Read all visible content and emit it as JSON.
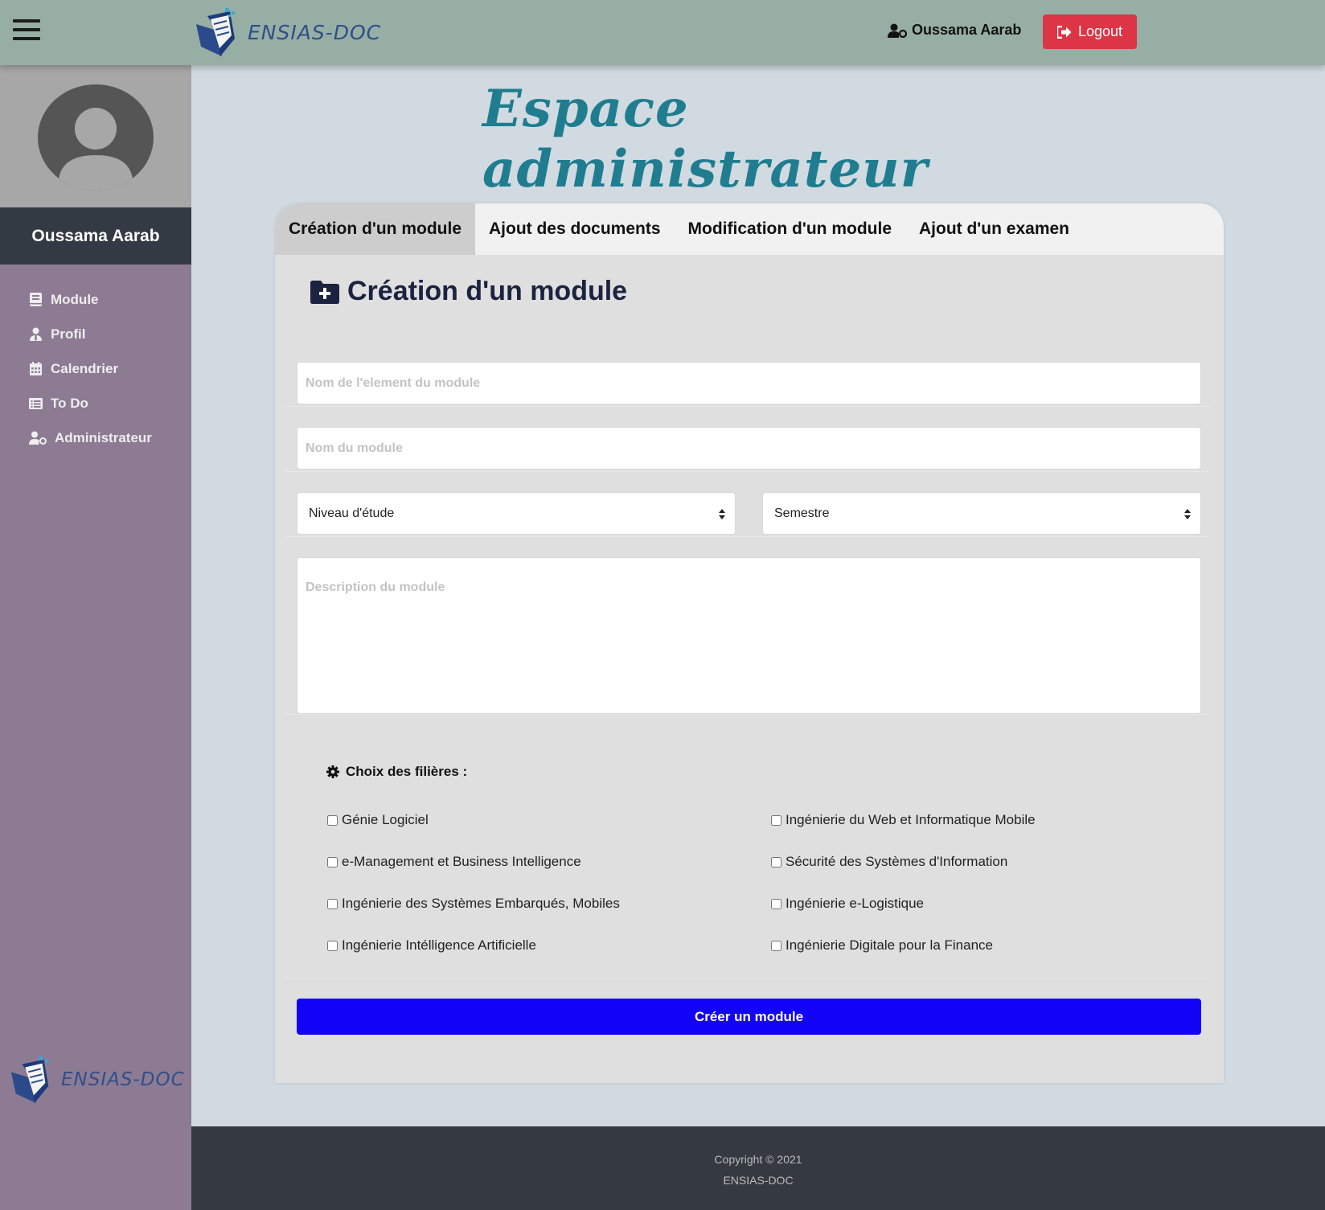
{
  "topbar": {
    "brand": "ENSIAS-DOC",
    "user_name": "Oussama Aarab",
    "logout_label": "Logout"
  },
  "sidebar": {
    "user_name": "Oussama Aarab",
    "items": [
      {
        "label": "Module",
        "icon": "book-icon"
      },
      {
        "label": "Profil",
        "icon": "user-tie-icon"
      },
      {
        "label": "Calendrier",
        "icon": "calendar-icon"
      },
      {
        "label": "To Do",
        "icon": "list-icon"
      },
      {
        "label": "Administrateur",
        "icon": "user-cog-icon"
      }
    ],
    "brand": "ENSIAS-DOC"
  },
  "main": {
    "title": "Espace administrateur",
    "tabs": [
      {
        "label": "Création d'un module",
        "active": true
      },
      {
        "label": "Ajout des documents",
        "active": false
      },
      {
        "label": "Modification d'un module",
        "active": false
      },
      {
        "label": "Ajout d'un examen",
        "active": false
      }
    ],
    "form": {
      "heading": "Création d'un module",
      "element_placeholder": "Nom de l'element du module",
      "module_placeholder": "Nom du module",
      "niveau_label": "Niveau d'étude",
      "semestre_label": "Semestre",
      "description_placeholder": "Description du module",
      "filieres_title": "Choix des filières :",
      "filieres": [
        "Génie Logiciel",
        "Ingénierie du Web et Informatique Mobile",
        "e-Management et Business Intelligence",
        "Sécurité des Systèmes d'Information",
        "Ingénierie des Systèmes Embarqués, Mobiles",
        "Ingénierie e-Logistique",
        "Ingénierie Intélligence Artificielle",
        "Ingénierie Digitale pour la Finance"
      ],
      "submit_label": "Créer un module"
    }
  },
  "footer": {
    "copyright": "Copyright © 2021",
    "name": "ENSIAS-DOC"
  },
  "colors": {
    "topbar": "#97aea5",
    "sidebar": "#8d7b94",
    "logout": "#dc3545",
    "submit": "#1302f8",
    "footer": "#343a40"
  }
}
